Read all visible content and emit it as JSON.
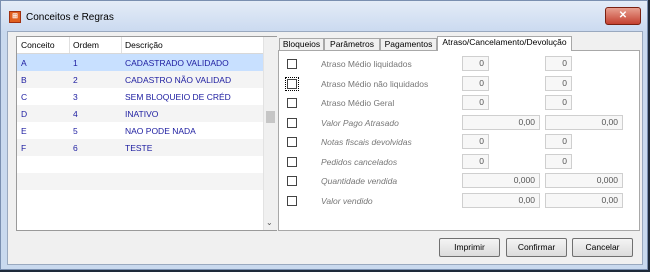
{
  "window": {
    "title": "Conceitos e Regras",
    "close_icon": "close-x-icon",
    "app_icon": "app-logo-icon"
  },
  "list": {
    "columns": [
      "Conceito",
      "Ordem",
      "Descrição"
    ],
    "rows": [
      {
        "conceito": "A",
        "ordem": "1",
        "descricao": "CADASTRADO VALIDADO"
      },
      {
        "conceito": "B",
        "ordem": "2",
        "descricao": "CADASTRO NÃO VALIDAD"
      },
      {
        "conceito": "C",
        "ordem": "3",
        "descricao": "SEM BLOQUEIO DE CRÉD"
      },
      {
        "conceito": "D",
        "ordem": "4",
        "descricao": "INATIVO"
      },
      {
        "conceito": "E",
        "ordem": "5",
        "descricao": "NAO PODE NADA"
      },
      {
        "conceito": "F",
        "ordem": "6",
        "descricao": "TESTE"
      }
    ],
    "selected_row": 0
  },
  "tabs": [
    "Bloqueios",
    "Parâmetros",
    "Pagamentos",
    "Atraso/Cancelamento/Devolução"
  ],
  "active_tab": 3,
  "fields": [
    {
      "label": "Atraso Médio liquidados",
      "value1": "0",
      "value2": "0"
    },
    {
      "label": "Atraso Médio não liquidados",
      "value1": "0",
      "value2": "0"
    },
    {
      "label": "Atraso Médio Geral",
      "value1": "0",
      "value2": "0"
    },
    {
      "label": "Valor Pago Atrasado",
      "value1": "0,00",
      "value2": "0,00"
    },
    {
      "label": "Notas fiscais devolvidas",
      "value1": "0",
      "value2": "0"
    },
    {
      "label": "Pedidos cancelados",
      "value1": "0",
      "value2": "0"
    },
    {
      "label": "Quantidade vendida",
      "value1": "0,000",
      "value2": "0,000"
    },
    {
      "label": "Valor vendido",
      "value1": "0,00",
      "value2": "0,00"
    }
  ],
  "buttons": {
    "imprimir": "Imprimir",
    "confirmar": "Confirmar",
    "cancelar": "Cancelar"
  }
}
